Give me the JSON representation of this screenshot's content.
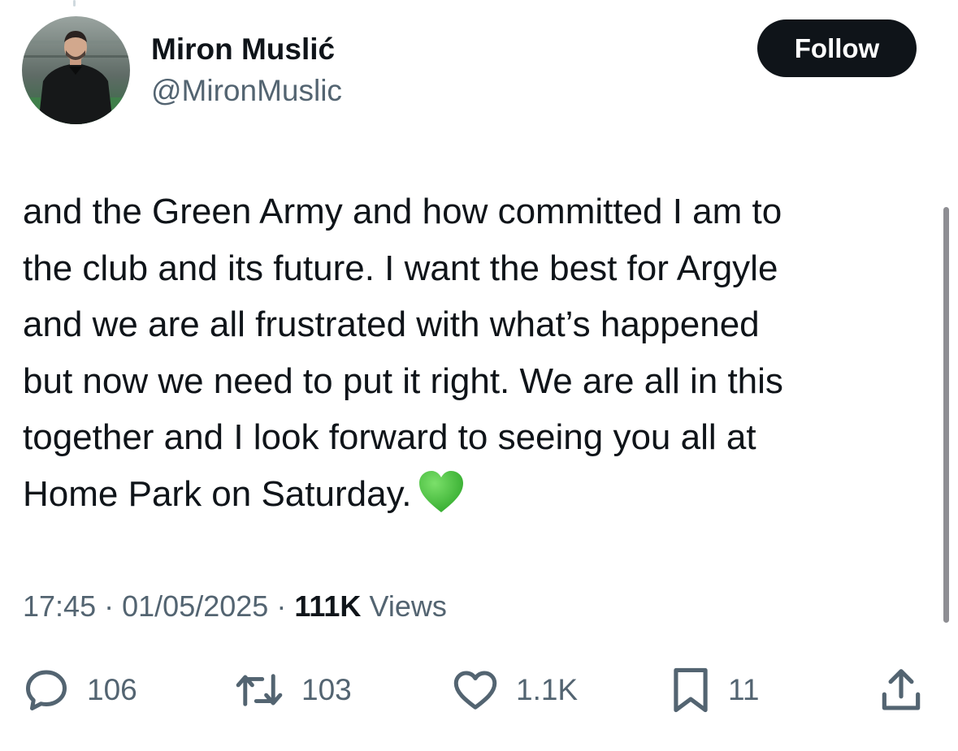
{
  "user": {
    "name": "Miron Muslić",
    "handle": "@MironMuslic"
  },
  "follow_button": {
    "label": "Follow"
  },
  "tweet": {
    "lines": [
      "and the Green Army and how committed I am to",
      "the club and its future. I want the best for Argyle",
      "and we are all frustrated with what’s happened",
      "but now we need to put it right. We are all in this",
      "together and I look forward to seeing you all at",
      "Home Park on Saturday."
    ],
    "emoji": "green-heart"
  },
  "meta": {
    "time": "17:45",
    "separator": "·",
    "date": "01/05/2025",
    "views_count": "111K",
    "views_label": "Views"
  },
  "actions": {
    "replies": "106",
    "reposts": "103",
    "likes": "1.1K",
    "bookmarks": "11"
  },
  "colors": {
    "text": "#0f1419",
    "secondary": "#536471",
    "button_bg": "#0f1419",
    "heart_green": "#3dbb2f"
  }
}
